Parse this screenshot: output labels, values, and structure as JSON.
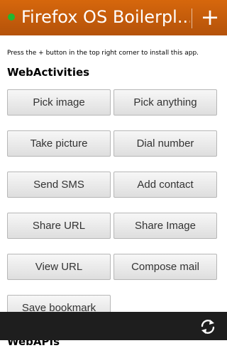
{
  "header": {
    "title": "Firefox OS Boilerpl...",
    "install_label": "+",
    "status_icon": "status-dot-icon"
  },
  "instructions": "Press the + button in the top right corner to install this app.",
  "sections": {
    "webactivities": "WebActivities",
    "next_partial": "WebAPIs"
  },
  "buttons": {
    "pick_image": "Pick image",
    "pick_anything": "Pick anything",
    "take_picture": "Take picture",
    "dial_number": "Dial number",
    "send_sms": "Send SMS",
    "add_contact": "Add contact",
    "share_url": "Share URL",
    "share_image": "Share Image",
    "view_url": "View URL",
    "compose_mail": "Compose mail",
    "save_bookmark": "Save bookmark"
  },
  "toolbar": {
    "reload_icon": "reload-icon"
  },
  "colors": {
    "header": "#c75d0b",
    "status_dot": "#22b82f",
    "toolbar": "#1e1e1e"
  }
}
